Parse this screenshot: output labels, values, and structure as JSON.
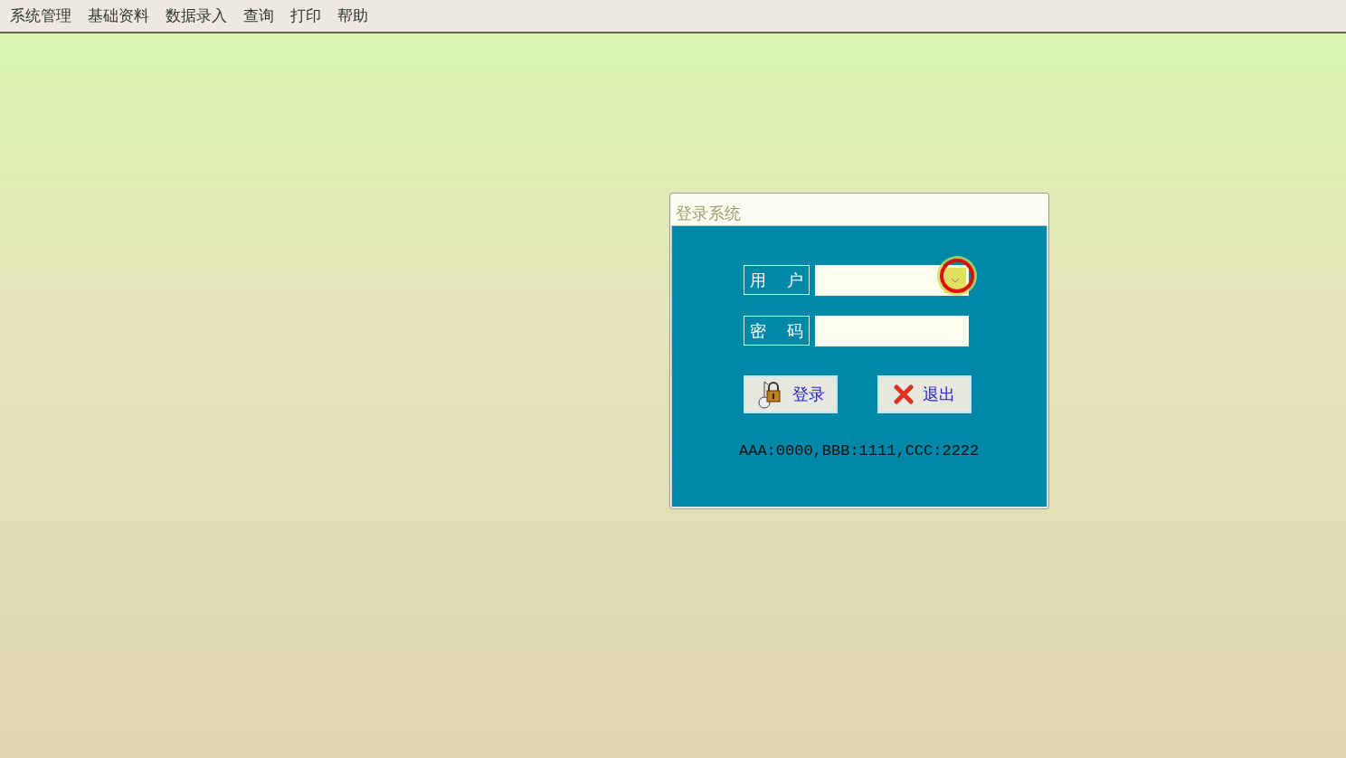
{
  "menu": [
    "系统管理",
    "基础资料",
    "数据录入",
    "查询",
    "打印",
    "帮助"
  ],
  "dialog": {
    "title": "登录系统",
    "fields": [
      {
        "label": "用 户",
        "kind": "combo"
      },
      {
        "label": "密 码",
        "kind": "password"
      }
    ],
    "buttons": [
      {
        "label": "登录",
        "kind": "login"
      },
      {
        "label": "退出",
        "kind": "exit"
      }
    ],
    "hint": "AAA:0000,BBB:1111,CCC:2222"
  }
}
